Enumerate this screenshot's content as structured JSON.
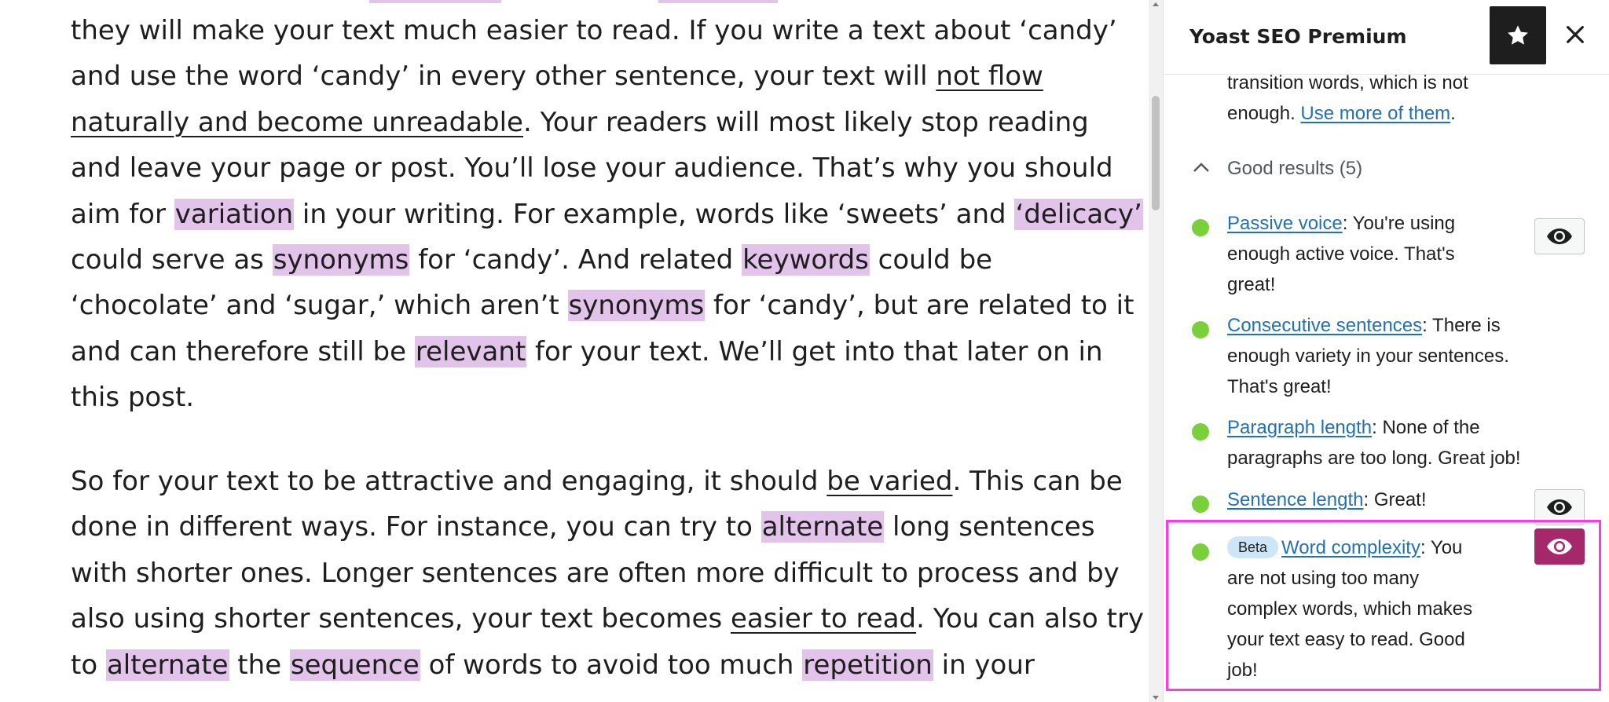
{
  "editor": {
    "para1": {
      "l1": "they will make your text much easier to read. If you write a text about ‘candy’",
      "l2": "and use the word ‘candy’ in every other sentence, your text will ",
      "l2_link": "not flow ",
      "l3_link": "naturally and become unreadable",
      "l3": ". Your readers will most likely stop reading",
      "l4": "and leave your page or post. You’ll lose your audience. That’s why you should",
      "l5_a": "aim for ",
      "l5_hl1": "variation",
      "l5_b": " in your writing. For example, words like ‘sweets’ and ",
      "l5_hl2": "‘delicacy’",
      "l6_a": "could serve as ",
      "l6_hl1": "synonyms",
      "l6_b": " for ‘candy’. And related ",
      "l6_hl2": "keywords",
      "l6_c": " could be",
      "l7_a": "‘chocolate’ and ‘sugar,’ which aren’t ",
      "l7_hl": "synonyms",
      "l7_b": " for ‘candy’, but are related to it",
      "l8_a": "and can therefore still be ",
      "l8_hl": "relevant",
      "l8_b": " for your text. We’ll get into that later on in",
      "l9": "this post."
    },
    "para2": {
      "l1_a": "So for your text to be attractive and engaging, it should ",
      "l1_link": "be varied",
      "l1_b": ". This can be",
      "l2_a": "done in different ways. For instance, you can try to ",
      "l2_hl": "alternate",
      "l2_b": " long sentences",
      "l3": "with shorter ones. Longer sentences are often more difficult to process and by",
      "l4_a": "also using shorter sentences, your text becomes ",
      "l4_link": "easier to read",
      "l4_b": ". You can also try",
      "l5_a": "to ",
      "l5_hl1": "alternate",
      "l5_b": " the ",
      "l5_hl2": "sequence",
      "l5_c": " of words to avoid too much ",
      "l5_hl3": "repetition",
      "l5_d": " in your"
    }
  },
  "sidebar": {
    "title": "Yoast SEO Premium",
    "previous_result": {
      "l1": "transition words, which is not",
      "l2": "enough. ",
      "link": "Use more of them",
      "end": "."
    },
    "good_results_label": "Good results (5)",
    "results": [
      {
        "link": "Passive voice",
        "text": ": You're using",
        "l2": "enough active voice. That's",
        "l3": "great!",
        "has_eye": true
      },
      {
        "link": "Consecutive sentences",
        "text": ": There is",
        "l2": "enough variety in your sentences.",
        "l3": "That's great!",
        "has_eye": false
      },
      {
        "link": "Paragraph length",
        "text": ": None of the",
        "l2": "paragraphs are too long. Great job!",
        "has_eye": false
      },
      {
        "link": "Sentence length",
        "text": ": Great!",
        "has_eye": true
      },
      {
        "badge": "Beta",
        "link": "Word complexity",
        "text": ": You",
        "l2": "are not using too many",
        "l3": "complex words, which makes",
        "l4": "your text easy to read. Good",
        "l5": "job!",
        "has_eye": true,
        "eye_active": true
      }
    ]
  },
  "colors": {
    "highlight": "#e2c3ea",
    "link": "#2271b1",
    "good_dot": "#7ad03a",
    "active_eye": "#a4286a",
    "focus_outline": "#ff38e8"
  }
}
